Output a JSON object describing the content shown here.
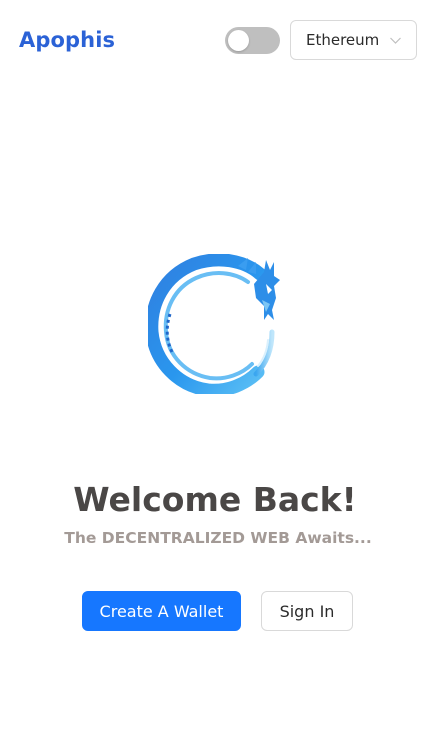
{
  "header": {
    "app_name": "Apophis",
    "theme_toggle": {
      "on": false
    },
    "network_select": {
      "selected": "Ethereum"
    }
  },
  "main": {
    "title": "Welcome Back!",
    "subtitle": "The DECENTRALIZED WEB Awaits...",
    "actions": {
      "create_wallet_label": "Create A Wallet",
      "sign_in_label": "Sign In"
    }
  },
  "icons": {
    "logo": "dragon-ouroboros-icon",
    "select_arrow": "chevron-down-icon"
  },
  "colors": {
    "brand": "#2b62d6",
    "primary_button": "#1677ff",
    "toggle_off": "#bfbfbf",
    "logo_blue": "#2d8ee8",
    "logo_light_blue": "#7cc6f5"
  }
}
